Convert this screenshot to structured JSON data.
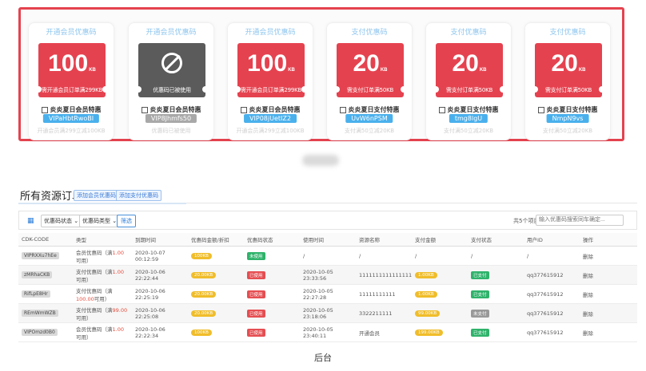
{
  "showcase": {
    "coupons": [
      {
        "title": "开通会员优惠码",
        "amount": "100",
        "unit": "KB",
        "disabled": false,
        "note": "需开通会员订单满299KB",
        "name": "炎炎夏日会员特惠",
        "code": "VIPaHbtRwoBI",
        "footer": "开通会员满299立减100KB"
      },
      {
        "title": "开通会员优惠码",
        "amount": "",
        "unit": "",
        "disabled": true,
        "note": "优惠码已被使用",
        "name": "炎炎夏日会员特惠",
        "code": "VIP8Jhmfs50",
        "footer": "优惠码已被使用"
      },
      {
        "title": "开通会员优惠码",
        "amount": "100",
        "unit": "KB",
        "disabled": false,
        "note": "需开通会员订单满299KB",
        "name": "炎炎夏日会员特惠",
        "code": "VIP08jUetIZ2",
        "footer": "开通会员满299立减100KB"
      },
      {
        "title": "支付优惠码",
        "amount": "20",
        "unit": "KB",
        "disabled": false,
        "note": "需支付订单满50KB",
        "name": "炎炎夏日支付特惠",
        "code": "UvW6nPSM",
        "footer": "支付满50立减20KB"
      },
      {
        "title": "支付优惠码",
        "amount": "20",
        "unit": "KB",
        "disabled": false,
        "note": "需支付订单满50KB",
        "name": "炎炎夏日支付特惠",
        "code": "tmg8lgU",
        "footer": "支付满50立减20KB"
      },
      {
        "title": "支付优惠码",
        "amount": "20",
        "unit": "KB",
        "disabled": false,
        "note": "需支付订单满50KB",
        "name": "炎炎夏日支付特惠",
        "code": "NmpN9vs",
        "footer": "支付满50立减20KB"
      }
    ]
  },
  "panel": {
    "title": "所有资源订单",
    "add_member_code": "添加会员优惠码",
    "add_pay_code": "添加支付优惠码",
    "filter_status": "优惠码状态",
    "filter_type": "优惠码类型",
    "filter_button": "筛选",
    "count_text": "共5个项目",
    "search_placeholder": "输入优惠码搜索同车确定..."
  },
  "table": {
    "headers": [
      "CDK-CODE",
      "类型",
      "到期时间",
      "优惠码金额/折扣",
      "优惠码状态",
      "使用时间",
      "资源名称",
      "支付金额",
      "支付状态",
      "用户ID",
      "操作"
    ],
    "rows": [
      {
        "code": "VIPRXXu7hEe",
        "type_prefix": "会员优惠码（满",
        "type_amount": "1.00",
        "type_suffix": "可用）",
        "expire": "2020-10-07 00:12:59",
        "discount": "100KB",
        "status": "未使用",
        "status_color": "green",
        "used_time": "/",
        "resource": "/",
        "pay_amount": "/",
        "pay_status": "/",
        "user_id": "/",
        "action": "删除"
      },
      {
        "code": "zMRhaCKB",
        "type_prefix": "支付优惠码（满",
        "type_amount": "1.00",
        "type_suffix": "可用）",
        "expire": "2020-10-06 22:22:44",
        "discount": "20.00KB",
        "status": "已使用",
        "status_color": "red",
        "used_time": "2020-10-05 23:33:56",
        "resource": "1111111111111111",
        "pay_amount": "1.00KB",
        "pay_status": "已支付",
        "pay_status_color": "green",
        "user_id": "qq377615912",
        "action": "删除"
      },
      {
        "code": "RifLpE8Hr",
        "type_prefix": "支付优惠码（满",
        "type_amount": "100.00",
        "type_suffix": "可用）",
        "expire": "2020-10-06 22:25:19",
        "discount": "20.00KB",
        "status": "已使用",
        "status_color": "red",
        "used_time": "2020-10-05 22:27:28",
        "resource": "11111111111",
        "pay_amount": "1.00KB",
        "pay_status": "已支付",
        "pay_status_color": "green",
        "user_id": "qq377615912",
        "action": "删除"
      },
      {
        "code": "REmWmWZB",
        "type_prefix": "支付优惠码（满",
        "type_amount": "99.00",
        "type_suffix": "可用）",
        "expire": "2020-10-06 22:25:08",
        "discount": "20.00KB",
        "status": "已使用",
        "status_color": "red",
        "used_time": "2020-10-05 23:18:06",
        "resource": "3322211111",
        "pay_amount": "99.00KB",
        "pay_status": "未支付",
        "pay_status_color": "gray",
        "user_id": "qq377615912",
        "action": "删除"
      },
      {
        "code": "VIPOmzd0B0",
        "type_prefix": "会员优惠码（满",
        "type_amount": "1.00",
        "type_suffix": "可用）",
        "expire": "2020-10-06 22:22:34",
        "discount": "100KB",
        "status": "已使用",
        "status_color": "red",
        "used_time": "2020-10-05 23:40:11",
        "resource": "开通会员",
        "pay_amount": "199.00KB",
        "pay_status": "已支付",
        "pay_status_color": "green",
        "user_id": "qq377615912",
        "action": "删除"
      }
    ]
  },
  "caption": "后台",
  "colors": {
    "accent_red": "#e4424e",
    "ticket_gray": "#5b5b5b",
    "code_blue": "#4ab0ec",
    "link_blue": "#2f7fd9"
  }
}
